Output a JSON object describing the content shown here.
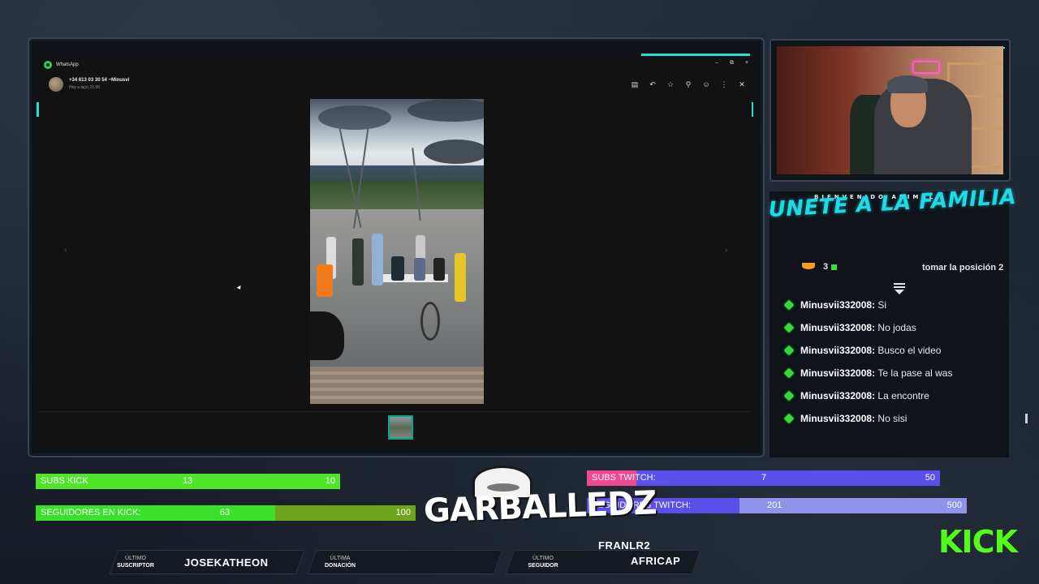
{
  "whatsapp": {
    "app_title": "WhatsApp",
    "contact_name": "+34 613 03 30 54 ~Minusvi",
    "contact_time": "Hoy a la(s) 21:00",
    "window_controls": {
      "minimize": "–",
      "restore": "⧉",
      "close": "×"
    },
    "header_icons": [
      "caption-icon",
      "reply-icon",
      "star-icon",
      "pin-icon",
      "emoji-icon",
      "more-icon",
      "close-icon"
    ],
    "nav_prev": "‹",
    "nav_next": "›"
  },
  "overlay": {
    "welcome_text": "BIENVENIDO ANIMAL",
    "banner_text": "UNETE A LA FAMILIA",
    "prev_message": {
      "num": "3",
      "right_text": "tomar la posición 2"
    }
  },
  "chat": {
    "messages": [
      {
        "user": "Minusvii332008",
        "text": "Si"
      },
      {
        "user": "Minusvii332008",
        "text": "No jodas"
      },
      {
        "user": "Minusvii332008",
        "text": "Busco el video"
      },
      {
        "user": "Minusvii332008",
        "text": "Te la pase al was"
      },
      {
        "user": "Minusvii332008",
        "text": "La encontre"
      },
      {
        "user": "Minusvii332008",
        "text": "No sisi"
      }
    ]
  },
  "goals": {
    "subs_kick": {
      "label": "SUBS KICK",
      "current": "13",
      "goal": "10",
      "progress": 1.0,
      "color": "#4fe52a"
    },
    "seguidores_kick": {
      "label": "SEGUIDORES EN KICK:",
      "current": "63",
      "goal": "100",
      "progress": 0.63,
      "color": "#39e12b"
    },
    "subs_twitch": {
      "label": "SUBS TWITCH:",
      "current": "7",
      "goal": "50",
      "progress": 0.14,
      "color": "#ef4a91"
    },
    "seguidores_twitch": {
      "label": "SEGUIDORES TWITCH:",
      "current": "201",
      "goal": "500",
      "progress": 0.402,
      "color": "#5c4ee8"
    }
  },
  "logo_text": "GARBALLEDZ",
  "bottom": {
    "suscriptor_label_top": "ÚLTIMO",
    "suscriptor_label_bottom": "SUSCRIPTOR",
    "suscriptor_value": "JOSEKATHEON",
    "donacion_label_top": "ÚLTIMA",
    "donacion_label_bottom": "DONACIÓN",
    "donacion_value": "",
    "seguidor_label_top": "ÚLTIMO",
    "seguidor_label_bottom": "SEGUIDOR",
    "seguidor_value_1": "FRANLR2",
    "seguidor_value_2": "AFRICAP"
  },
  "kick_brand": "KICK"
}
